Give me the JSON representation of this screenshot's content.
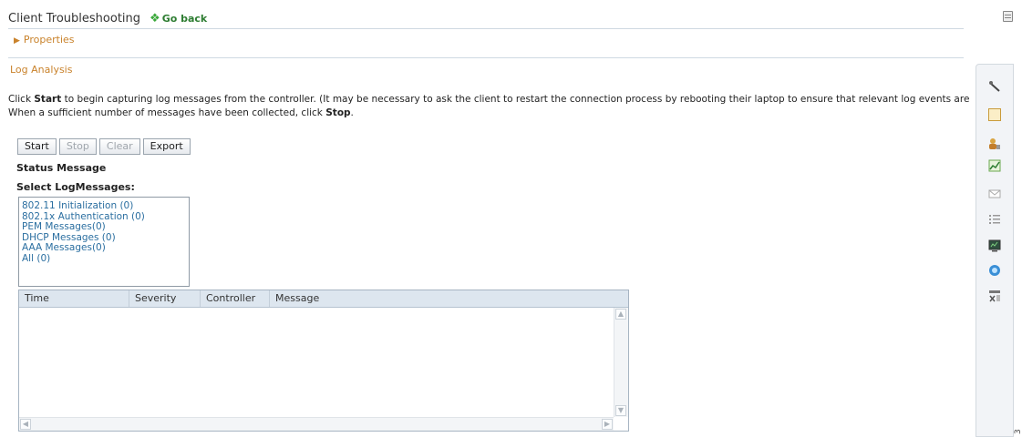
{
  "header": {
    "title": "Client Troubleshooting",
    "go_back": "Go back"
  },
  "properties": {
    "label": "Properties"
  },
  "log_analysis": {
    "title": "Log Analysis",
    "line1_pre": "Click ",
    "line1_start": "Start",
    "line1_post": " to begin capturing log messages from the controller. (It may be necessary to ask the client to restart the connection process by rebooting their laptop to ensure that relevant log events are generated.)",
    "line2_pre": "When a sufficient number of messages have been collected, click ",
    "line2_stop": "Stop",
    "line2_post": ".",
    "buttons": {
      "start": "Start",
      "stop": "Stop",
      "clear": "Clear",
      "export": "Export"
    },
    "status_message": "Status Message",
    "select_label": "Select LogMessages:",
    "messages": [
      "802.11 Initialization (0)",
      "802.1x Authentication (0)",
      "PEM Messages(0)",
      "DHCP Messages (0)",
      "AAA Messages(0)",
      "All (0)"
    ]
  },
  "table": {
    "columns": [
      "Time",
      "Severity",
      "Controller",
      "Message"
    ]
  },
  "sidebar": {
    "icons": [
      "tools-icon",
      "report-icon",
      "users-icon",
      "chart-icon",
      "mail-icon",
      "list-icon",
      "monitor-icon",
      "globe-icon",
      "filter-icon"
    ],
    "active_index": 1
  },
  "watermark": "3"
}
